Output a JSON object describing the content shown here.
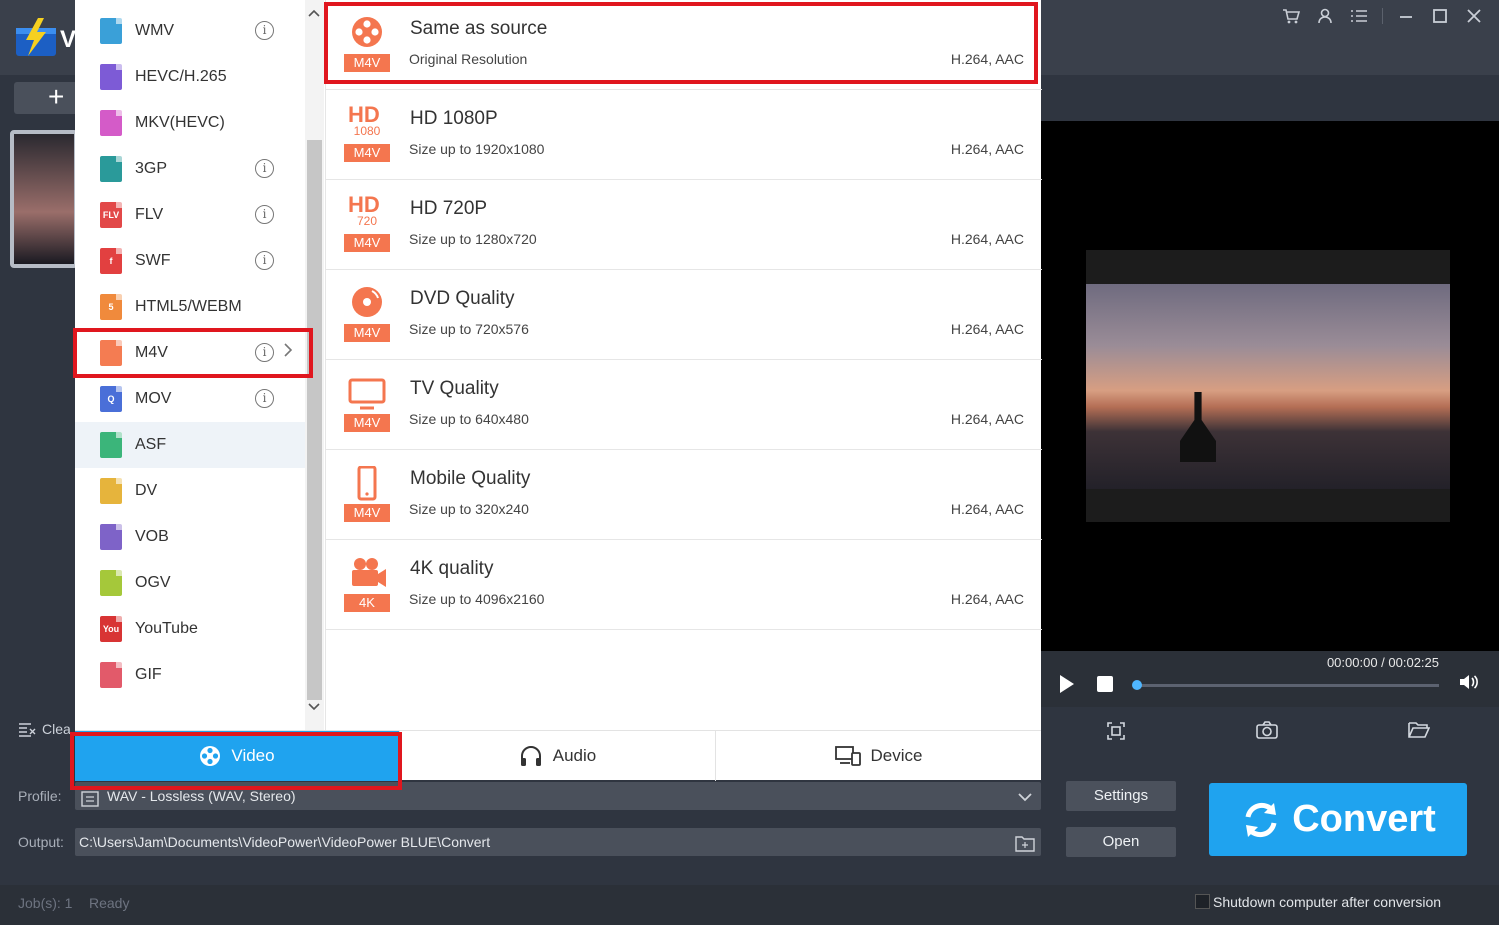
{
  "app": {
    "logo_letter": "V"
  },
  "window_controls": [
    "cart-icon",
    "user-icon",
    "menu-icon",
    "minimize-icon",
    "maximize-icon",
    "close-icon"
  ],
  "sidebar_tools": {
    "clear_label": "Clea"
  },
  "player": {
    "time": "00:00:00 / 00:02:25"
  },
  "profile": {
    "label": "Profile:",
    "value": "WAV - Lossless (WAV, Stereo)"
  },
  "output": {
    "label": "Output:",
    "value": "C:\\Users\\Jam\\Documents\\VideoPower\\VideoPower BLUE\\Convert"
  },
  "buttons": {
    "settings": "Settings",
    "open": "Open",
    "convert": "Convert"
  },
  "status": {
    "jobs": "Job(s): 1",
    "state": "Ready",
    "shutdown_label": "Shutdown computer after conversion"
  },
  "formats": [
    {
      "label": "WMV",
      "color": "#3aa0d8",
      "glyph": "",
      "info": true
    },
    {
      "label": "HEVC/H.265",
      "color": "#7d5bd6",
      "glyph": "",
      "info": false
    },
    {
      "label": "MKV(HEVC)",
      "color": "#d45bc8",
      "glyph": "",
      "info": false
    },
    {
      "label": "3GP",
      "color": "#2a9a9a",
      "glyph": "",
      "info": true
    },
    {
      "label": "FLV",
      "color": "#e24848",
      "glyph": "FLV",
      "info": true
    },
    {
      "label": "SWF",
      "color": "#e24040",
      "glyph": "f",
      "info": true
    },
    {
      "label": "HTML5/WEBM",
      "color": "#f08a3c",
      "glyph": "5",
      "info": false
    },
    {
      "label": "M4V",
      "color": "#f47c52",
      "glyph": "",
      "info": true
    },
    {
      "label": "MOV",
      "color": "#4a6fd8",
      "glyph": "Q",
      "info": true
    },
    {
      "label": "ASF",
      "color": "#3bb57a",
      "glyph": "",
      "info": false
    },
    {
      "label": "DV",
      "color": "#e6b43c",
      "glyph": "",
      "info": false
    },
    {
      "label": "VOB",
      "color": "#7e63c8",
      "glyph": "",
      "info": false
    },
    {
      "label": "OGV",
      "color": "#a5c83a",
      "glyph": "",
      "info": false
    },
    {
      "label": "YouTube",
      "color": "#d83434",
      "glyph": "You",
      "info": false
    },
    {
      "label": "GIF",
      "color": "#e25a6a",
      "glyph": "",
      "info": false
    }
  ],
  "presets": [
    {
      "title": "Same as source",
      "sub": "Original Resolution",
      "codec": "H.264, AAC",
      "badge": "M4V",
      "icon": "film-reel-icon"
    },
    {
      "title": "HD 1080P",
      "sub": "Size up to 1920x1080",
      "codec": "H.264, AAC",
      "badge": "M4V",
      "icon": "hd-icon",
      "hd": "HD",
      "res": "1080"
    },
    {
      "title": "HD 720P",
      "sub": "Size up to 1280x720",
      "codec": "H.264, AAC",
      "badge": "M4V",
      "icon": "hd-icon",
      "hd": "HD",
      "res": "720"
    },
    {
      "title": "DVD Quality",
      "sub": "Size up to 720x576",
      "codec": "H.264, AAC",
      "badge": "M4V",
      "icon": "disc-icon"
    },
    {
      "title": "TV Quality",
      "sub": "Size up to 640x480",
      "codec": "H.264, AAC",
      "badge": "M4V",
      "icon": "tv-icon"
    },
    {
      "title": "Mobile Quality",
      "sub": "Size up to 320x240",
      "codec": "H.264, AAC",
      "badge": "M4V",
      "icon": "phone-icon"
    },
    {
      "title": "4K quality",
      "sub": "Size up to 4096x2160",
      "codec": "H.264, AAC",
      "badge": "4K",
      "icon": "camera-icon"
    }
  ],
  "tabs": [
    {
      "label": "Video",
      "icon": "film-reel-icon",
      "active": true
    },
    {
      "label": "Audio",
      "icon": "headphones-icon",
      "active": false
    },
    {
      "label": "Device",
      "icon": "devices-icon",
      "active": false
    }
  ]
}
